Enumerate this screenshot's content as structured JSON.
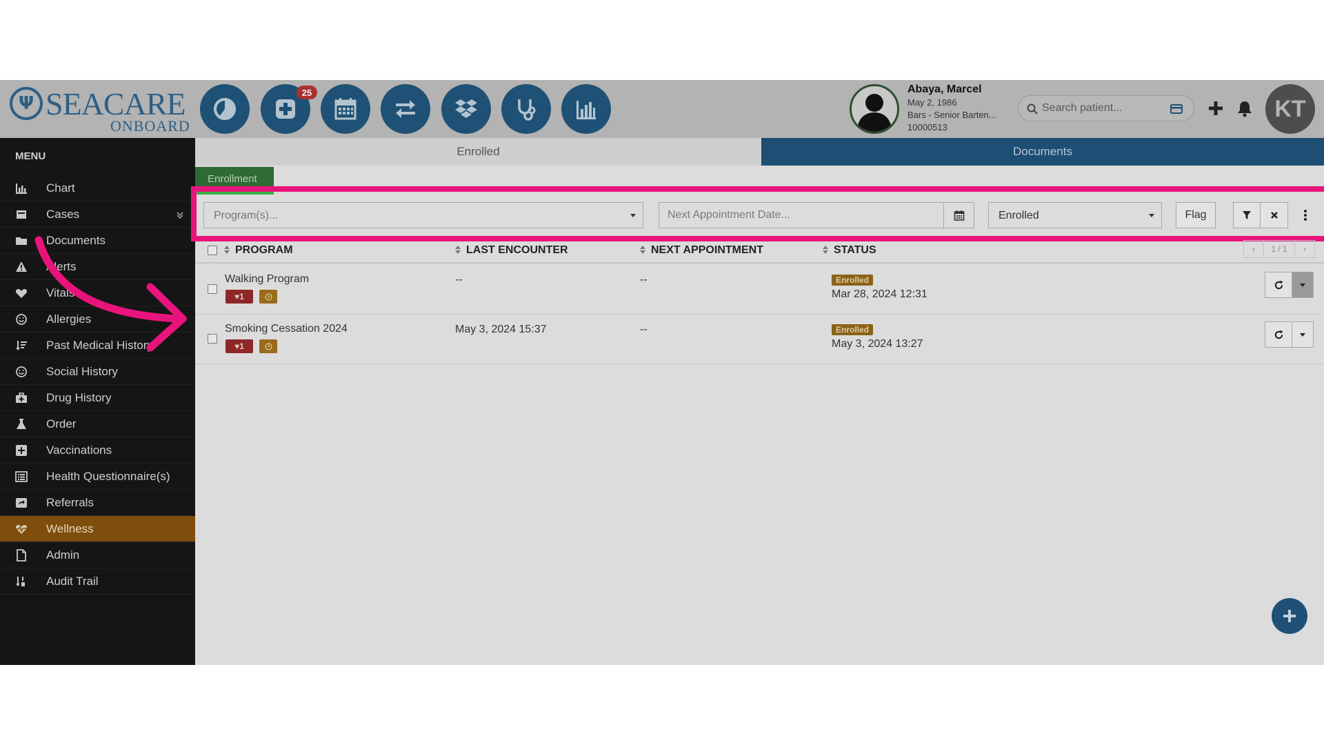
{
  "brand": {
    "name": "SEACARE",
    "sub": "ONBOARD"
  },
  "toolbar": {
    "tools": [
      {
        "name": "pie-chart-icon"
      },
      {
        "name": "medical-plus-icon",
        "badge": "25"
      },
      {
        "name": "calendar-icon"
      },
      {
        "name": "exchange-icon"
      },
      {
        "name": "dropbox-icon"
      },
      {
        "name": "stethoscope-icon"
      },
      {
        "name": "bar-chart-icon"
      }
    ]
  },
  "patient": {
    "name": "Abaya, Marcel",
    "dob": "May 2, 1986",
    "role": "Bars - Senior Barten...",
    "id": "10000513"
  },
  "search": {
    "placeholder": "Search patient..."
  },
  "user": {
    "initials": "KT"
  },
  "menu": {
    "title": "MENU",
    "items": [
      {
        "label": "Chart",
        "icon": "bar-chart-icon"
      },
      {
        "label": "Cases",
        "icon": "inbox-icon",
        "chevron": true
      },
      {
        "label": "Documents",
        "icon": "folder-icon"
      },
      {
        "label": "Alerts",
        "icon": "warning-icon"
      },
      {
        "label": "Vitals",
        "icon": "heart-icon"
      },
      {
        "label": "Allergies",
        "icon": "smile-icon"
      },
      {
        "label": "Past Medical History",
        "icon": "sort-amount-icon"
      },
      {
        "label": "Social History",
        "icon": "smile-icon"
      },
      {
        "label": "Drug History",
        "icon": "medkit-icon"
      },
      {
        "label": "Order",
        "icon": "flask-icon"
      },
      {
        "label": "Vaccinations",
        "icon": "plus-square-icon"
      },
      {
        "label": "Health Questionnaire(s)",
        "icon": "list-alt-icon"
      },
      {
        "label": "Referrals",
        "icon": "share-square-icon"
      },
      {
        "label": "Wellness",
        "icon": "heartbeat-icon",
        "active": true
      },
      {
        "label": "Admin",
        "icon": "file-icon"
      },
      {
        "label": "Audit Trail",
        "icon": "sort-numeric-icon"
      }
    ]
  },
  "tabs": {
    "enrolled": "Enrolled",
    "documents": "Documents"
  },
  "subtab": {
    "label": "Enrollment"
  },
  "filters": {
    "programs_placeholder": "Program(s)...",
    "appointment_placeholder": "Next Appointment Date...",
    "status_value": "Enrolled",
    "flag_label": "Flag"
  },
  "table": {
    "columns": [
      "PROGRAM",
      "LAST ENCOUNTER",
      "NEXT APPOINTMENT",
      "STATUS"
    ],
    "pager": {
      "prev": "‹",
      "page": "1 / 1",
      "next": "›"
    },
    "rows": [
      {
        "program": "Walking Program",
        "flag_count": "♥1",
        "last_encounter": "--",
        "next_appointment": "--",
        "status": "Enrolled",
        "status_date": "Mar 28, 2024 12:31"
      },
      {
        "program": "Smoking Cessation 2024",
        "flag_count": "♥1",
        "last_encounter": "May 3, 2024 15:37",
        "next_appointment": "--",
        "status": "Enrolled",
        "status_date": "May 3, 2024 13:27"
      }
    ]
  },
  "colors": {
    "primary": "#1e5175",
    "active_menu": "#7f4d0c",
    "highlight": "#e8147c",
    "enrolled_badge": "#8a6317",
    "flag_badge": "#8e2727"
  }
}
